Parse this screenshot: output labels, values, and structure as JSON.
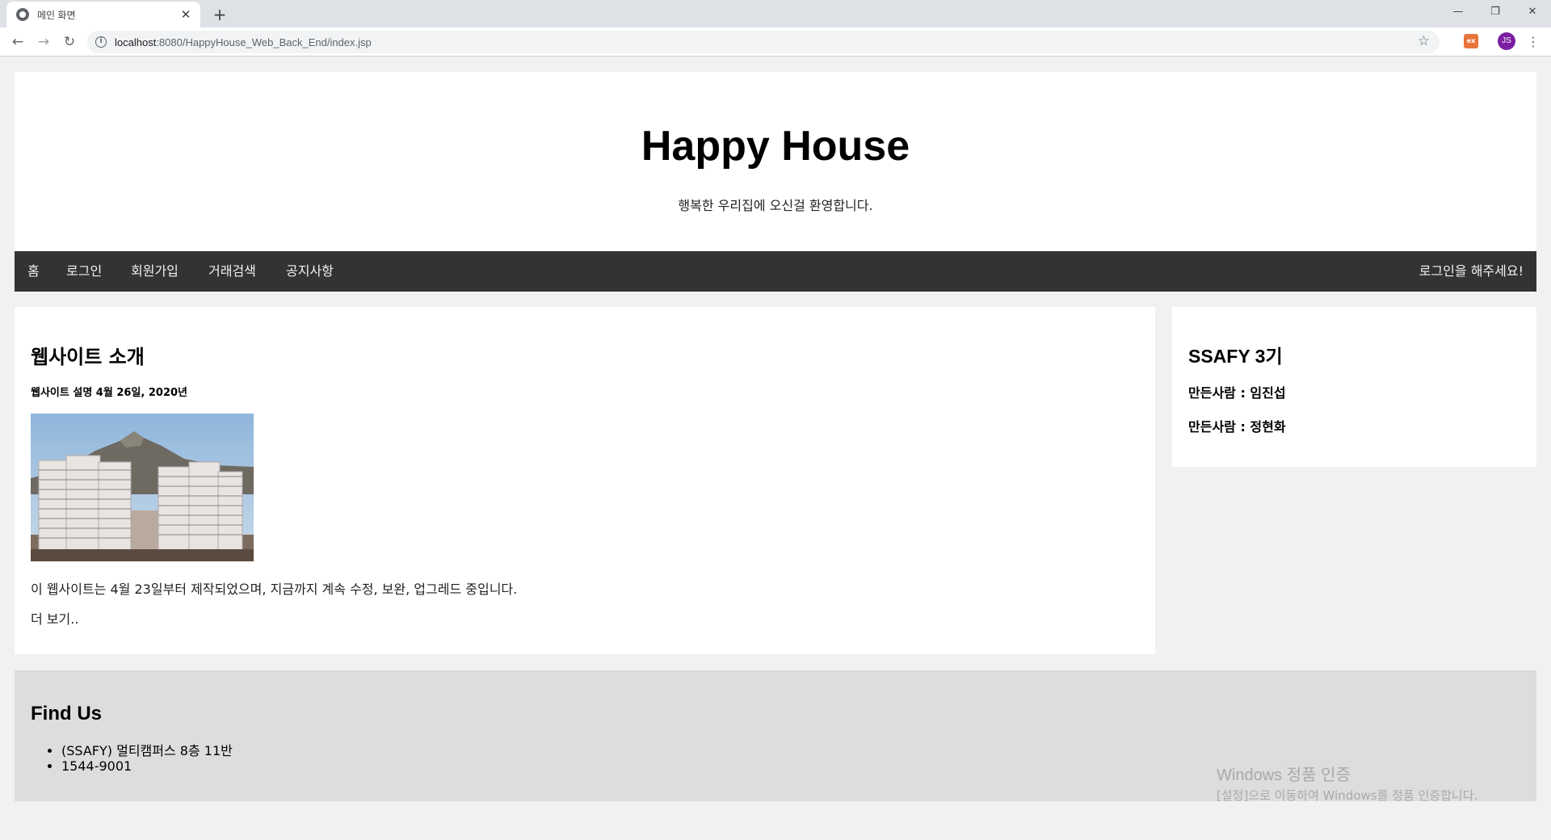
{
  "browser": {
    "tab_title": "메인 화면",
    "tab_close": "✕",
    "new_tab": "+",
    "url_host": "localhost",
    "url_rest": ":8080/HappyHouse_Web_Back_End/index.jsp",
    "profile_initials": "JS",
    "extension_label": "ex",
    "window_controls": [
      "—",
      "❐",
      "✕"
    ]
  },
  "header": {
    "title": "Happy House",
    "subtitle": "행복한 우리집에 오신걸 환영합니다."
  },
  "nav": {
    "items": [
      "홈",
      "로그인",
      "회원가입",
      "거래검색",
      "공지사항"
    ],
    "right_text": "로그인을 해주세요!"
  },
  "main": {
    "title": "웹사이트 소개",
    "meta": "웹사이트 설명 4월 26일, 2020년",
    "body": "이 웹사이트는 4월 23일부터 제작되었으며, 지금까지 계속 수정, 보완, 업그레드 중입니다.",
    "more": "더 보기.."
  },
  "sidebar": {
    "title": "SSAFY 3기",
    "lines": [
      "만든사람 : 임진섭",
      "만든사람 : 정현화"
    ]
  },
  "footer": {
    "title": "Find Us",
    "items": [
      "(SSAFY) 멀티캠퍼스 8층 11반",
      "1544-9001"
    ]
  },
  "watermark": {
    "line1": "Windows 정품 인증",
    "line2": "[설정]으로 이동하여 Windows를 정품 인증합니다."
  }
}
